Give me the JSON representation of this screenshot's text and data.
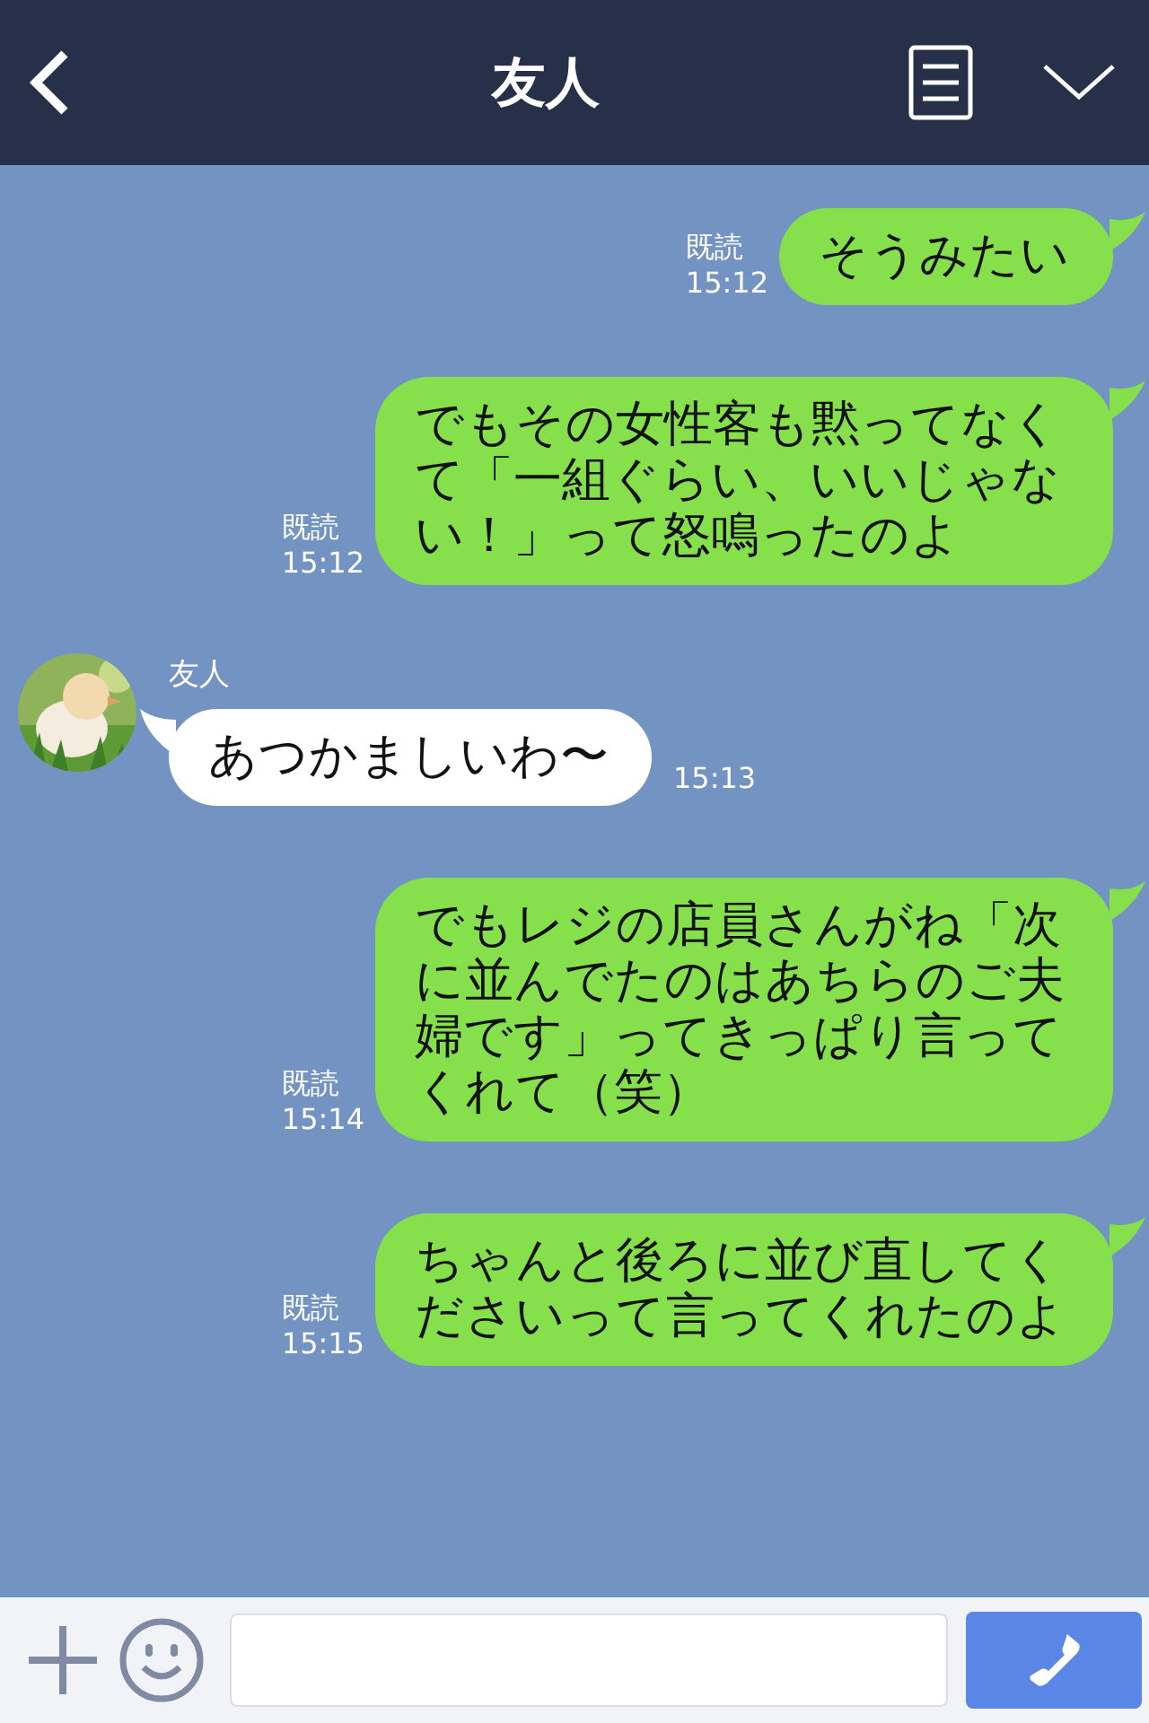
{
  "header": {
    "title": "友人"
  },
  "messages": [
    {
      "kind": "sent",
      "text": "そうみたい",
      "read": "既読",
      "time": "15:12"
    },
    {
      "kind": "sent",
      "text": "でもその女性客も黙ってなくて「一組ぐらい、いいじゃない！」って怒鳴ったのよ",
      "read": "既読",
      "time": "15:12"
    },
    {
      "kind": "received",
      "name": "友人",
      "text": "あつかましいわ〜",
      "time": "15:13"
    },
    {
      "kind": "sent",
      "text": "でもレジの店員さんがね「次に並んでたのはあちらのご夫婦です」ってきっぱり言ってくれて（笑）",
      "read": "既読",
      "time": "15:14"
    },
    {
      "kind": "sent",
      "text": "ちゃんと後ろに並び直してくださいって言ってくれたのよ",
      "read": "既読",
      "time": "15:15"
    }
  ]
}
